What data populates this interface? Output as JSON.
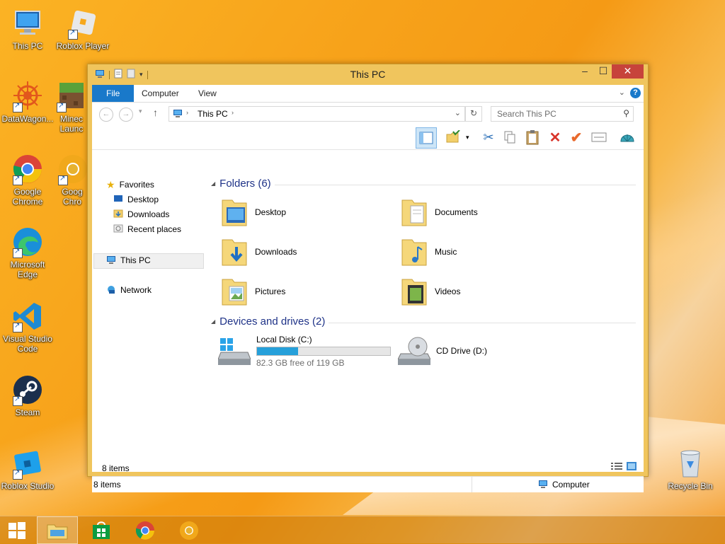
{
  "desktop": {
    "icons": [
      {
        "label": "This PC"
      },
      {
        "label": "Roblox Player"
      },
      {
        "label": "DataWagon..."
      },
      {
        "label": "Minec Launc"
      },
      {
        "label": "Google Chrome"
      },
      {
        "label": "Goog Chro"
      },
      {
        "label": "Microsoft Edge"
      },
      {
        "label": "Visual Studio Code"
      },
      {
        "label": "Steam"
      },
      {
        "label": "Roblox Studio"
      },
      {
        "label": "Recycle Bin"
      }
    ]
  },
  "window": {
    "title": "This PC",
    "controls": {
      "minimize": "–",
      "maximize": "☐",
      "close": "✕"
    },
    "ribbon_tabs": [
      {
        "label": "File"
      },
      {
        "label": "Computer"
      },
      {
        "label": "View"
      }
    ],
    "help_label": "?",
    "address": {
      "path": "This PC"
    },
    "search": {
      "placeholder": "Search This PC"
    },
    "navigation": {
      "favorites_label": "Favorites",
      "favorites": [
        {
          "label": "Desktop"
        },
        {
          "label": "Downloads"
        },
        {
          "label": "Recent places"
        }
      ],
      "this_pc_label": "This PC",
      "network_label": "Network"
    },
    "groups": {
      "folders_label": "Folders (6)",
      "drives_label": "Devices and drives (2)"
    },
    "folders": [
      {
        "label": "Desktop"
      },
      {
        "label": "Documents"
      },
      {
        "label": "Downloads"
      },
      {
        "label": "Music"
      },
      {
        "label": "Pictures"
      },
      {
        "label": "Videos"
      }
    ],
    "drives": [
      {
        "label": "Local Disk (C:)",
        "free_text": "82.3 GB free of 119 GB",
        "used_fraction": 0.31
      },
      {
        "label": "CD Drive (D:)"
      }
    ],
    "status": {
      "item_count": "8 items",
      "bar_count": "8 items",
      "bar_location": "Computer"
    }
  },
  "colors": {
    "accent": "#1979ca",
    "frame": "#f0c55d",
    "close": "#c7433b",
    "drive_bar": "#26a0da"
  }
}
